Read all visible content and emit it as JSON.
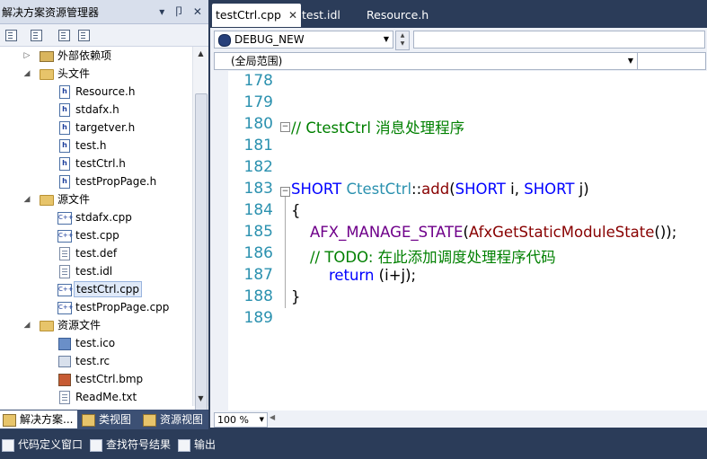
{
  "solution_explorer": {
    "title": "解决方案资源管理器",
    "title_buttons": "▾ 卩 ✕",
    "toolbar_icons": [
      "properties-icon",
      "show-all-files-icon",
      "refresh-icon",
      "class-view-icon"
    ],
    "tree": [
      {
        "label": "外部依赖项",
        "icon": "folder-external-icon",
        "expander": "▷"
      },
      {
        "label": "头文件",
        "icon": "folder-open-icon",
        "expander": "◢"
      },
      {
        "label": "Resource.h",
        "icon": "header-file-icon"
      },
      {
        "label": "stdafx.h",
        "icon": "header-file-icon"
      },
      {
        "label": "targetver.h",
        "icon": "header-file-icon"
      },
      {
        "label": "test.h",
        "icon": "header-file-icon"
      },
      {
        "label": "testCtrl.h",
        "icon": "header-file-icon"
      },
      {
        "label": "testPropPage.h",
        "icon": "header-file-icon"
      },
      {
        "label": "源文件",
        "icon": "folder-open-icon",
        "expander": "◢"
      },
      {
        "label": "stdafx.cpp",
        "icon": "cpp-file-icon"
      },
      {
        "label": "test.cpp",
        "icon": "cpp-file-icon"
      },
      {
        "label": "test.def",
        "icon": "def-file-icon"
      },
      {
        "label": "test.idl",
        "icon": "idl-file-icon"
      },
      {
        "label": "testCtrl.cpp",
        "icon": "cpp-file-icon",
        "selected": true
      },
      {
        "label": "testPropPage.cpp",
        "icon": "cpp-file-icon"
      },
      {
        "label": "资源文件",
        "icon": "folder-open-icon",
        "expander": "◢"
      },
      {
        "label": "test.ico",
        "icon": "ico-file-icon"
      },
      {
        "label": "test.rc",
        "icon": "rc-file-icon"
      },
      {
        "label": "testCtrl.bmp",
        "icon": "bmp-file-icon"
      },
      {
        "label": "ReadMe.txt",
        "icon": "txt-file-icon"
      }
    ],
    "bottom_tabs": [
      {
        "label": "解决方案...",
        "icon": "solution-explorer-icon",
        "active": true
      },
      {
        "label": "类视图",
        "icon": "class-view-icon"
      },
      {
        "label": "资源视图",
        "icon": "resource-view-icon"
      }
    ]
  },
  "editor": {
    "tabs": [
      {
        "label": "testCtrl.cpp",
        "active": true,
        "close": "✕"
      },
      {
        "label": "test.idl"
      },
      {
        "label": "Resource.h"
      }
    ],
    "config_dropdown": "DEBUG_NEW",
    "scope_dropdown": "(全局范围)",
    "zoom": "100 %",
    "lines": [
      {
        "num": "178",
        "code": []
      },
      {
        "num": "179",
        "code": []
      },
      {
        "num": "180",
        "code": [
          {
            "t": "// CtestCtrl 消息处理程序",
            "c": "cm"
          }
        ]
      },
      {
        "num": "181",
        "code": []
      },
      {
        "num": "182",
        "code": []
      },
      {
        "num": "183",
        "code": [
          {
            "t": "SHORT",
            "c": "kw"
          },
          {
            "t": " ",
            "c": "op"
          },
          {
            "t": "CtestCtrl",
            "c": "ty"
          },
          {
            "t": "::",
            "c": "op"
          },
          {
            "t": "add",
            "c": "fn"
          },
          {
            "t": "(",
            "c": "op"
          },
          {
            "t": "SHORT",
            "c": "kw"
          },
          {
            "t": " i, ",
            "c": "op"
          },
          {
            "t": "SHORT",
            "c": "kw"
          },
          {
            "t": " j)",
            "c": "op"
          }
        ]
      },
      {
        "num": "184",
        "code": [
          {
            "t": "{",
            "c": "op"
          }
        ]
      },
      {
        "num": "185",
        "code": [
          {
            "t": "    ",
            "c": "op"
          },
          {
            "t": "AFX_MANAGE_STATE",
            "c": "mc"
          },
          {
            "t": "(",
            "c": "op"
          },
          {
            "t": "AfxGetStaticModuleState",
            "c": "fn"
          },
          {
            "t": "());",
            "c": "op"
          }
        ]
      },
      {
        "num": "186",
        "code": [
          {
            "t": "    ",
            "c": "op"
          },
          {
            "t": "// TODO: 在此添加调度处理程序代码",
            "c": "cm"
          }
        ]
      },
      {
        "num": "187",
        "code": [
          {
            "t": "        ",
            "c": "op"
          },
          {
            "t": "return",
            "c": "kw"
          },
          {
            "t": " (i+j);",
            "c": "op"
          }
        ]
      },
      {
        "num": "188",
        "code": [
          {
            "t": "}",
            "c": "op"
          }
        ]
      },
      {
        "num": "189",
        "code": []
      }
    ]
  },
  "bottom_panel": {
    "tabs": [
      {
        "label": "代码定义窗口",
        "icon": "code-definition-icon"
      },
      {
        "label": "查找符号结果",
        "icon": "find-symbol-icon"
      },
      {
        "label": "输出",
        "icon": "output-icon"
      }
    ]
  }
}
